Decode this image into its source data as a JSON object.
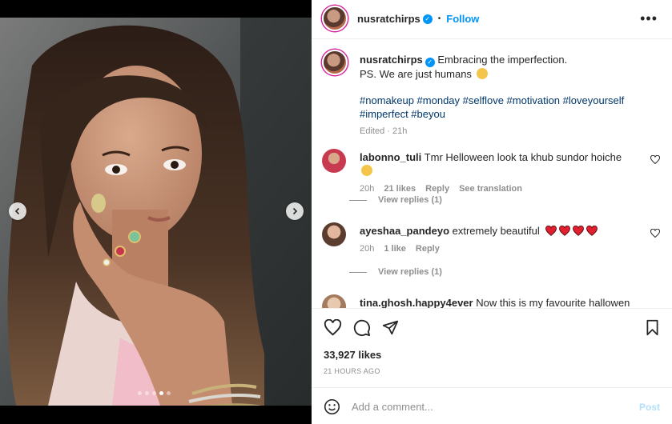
{
  "post": {
    "username": "nusratchirps",
    "follow_label": "Follow",
    "separator": "•",
    "more_label": "•••",
    "verified_glyph": "✓"
  },
  "caption": {
    "username": "nusratchirps",
    "line1": "Embracing the imperfection.",
    "line2": "PS. We are just humans",
    "hashtags_line1": "#nomakeup #monday #selflove #motivation #loveyourself",
    "hashtags_line2": "#imperfect #beyou",
    "edited": "Edited · 21h"
  },
  "comments": [
    {
      "username": "labonno_tuli",
      "text": "Tmr Helloween look ta khub sundor hoiche",
      "time": "20h",
      "likes": "21 likes",
      "reply": "Reply",
      "translate": "See translation",
      "view_replies": "View replies (1)"
    },
    {
      "username": "ayeshaa_pandeyo",
      "text": "extremely beautiful",
      "time": "20h",
      "likes": "1 like",
      "reply": "Reply",
      "view_replies": "View replies (1)"
    },
    {
      "username": "tina.ghosh.happy4ever",
      "text": "Now this is my favourite hallowen look"
    }
  ],
  "stats": {
    "likes": "33,927 likes",
    "time": "21 HOURS AGO"
  },
  "composer": {
    "placeholder": "Add a comment...",
    "post_label": "Post"
  },
  "carousel": {
    "slide_count": 5,
    "active_slide": 4
  },
  "colors": {
    "accent": "#0095f6",
    "heart_red": "#ed4956",
    "text": "#262626",
    "muted": "#8e8e8e",
    "hashtag": "#00376b"
  },
  "icons": {
    "like": "heart-outline-icon",
    "comment": "comment-bubble-icon",
    "share": "paper-plane-icon",
    "save": "bookmark-icon",
    "emoji": "smiley-icon",
    "prev": "chevron-left-icon",
    "next": "chevron-right-icon"
  }
}
